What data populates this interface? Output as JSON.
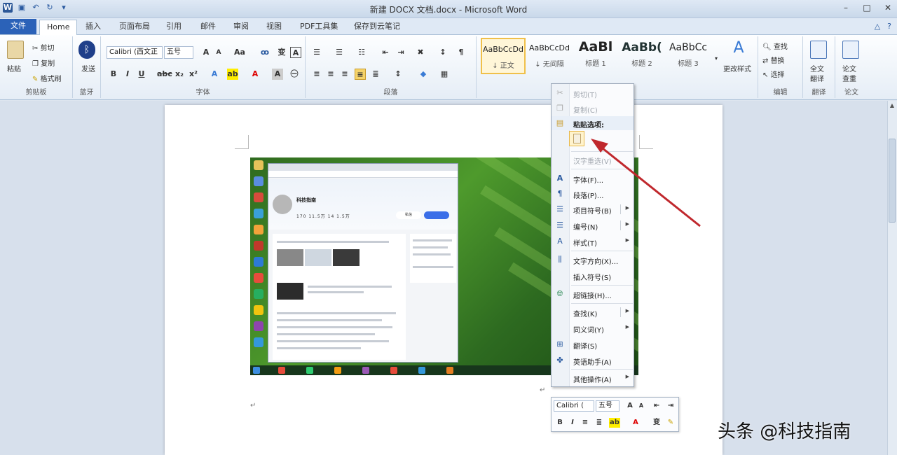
{
  "window": {
    "title": "新建 DOCX 文档.docx - Microsoft Word",
    "app_icon": "word-icon"
  },
  "tabs": [
    {
      "label": "文件"
    },
    {
      "label": "Home"
    },
    {
      "label": "插入"
    },
    {
      "label": "页面布局"
    },
    {
      "label": "引用"
    },
    {
      "label": "邮件"
    },
    {
      "label": "审阅"
    },
    {
      "label": "视图"
    },
    {
      "label": "PDF工具集"
    },
    {
      "label": "保存到云笔记"
    }
  ],
  "ribbon": {
    "clipboard": {
      "group_label": "剪贴板",
      "paste": "粘贴",
      "cut": "剪切",
      "copy": "复制",
      "format_painter": "格式刷"
    },
    "bluetooth": {
      "group_label": "蓝牙",
      "button": "发送"
    },
    "font": {
      "group_label": "字体",
      "font_name": "Calibri (西文正",
      "font_size": "五号"
    },
    "paragraph": {
      "group_label": "段落"
    },
    "styles": {
      "group_label": "样式",
      "items": [
        {
          "preview": "AaBbCcDd",
          "name": "↓ 正文"
        },
        {
          "preview": "AaBbCcDd",
          "name": "↓ 无间隔"
        },
        {
          "preview": "AaBl",
          "name": "标题 1"
        },
        {
          "preview": "AaBb(",
          "name": "标题 2"
        },
        {
          "preview": "AaBbCc",
          "name": "标题 3"
        }
      ],
      "change_styles": "更改样式"
    },
    "editing": {
      "group_label": "编辑",
      "find": "查找",
      "replace": "替换",
      "select": "选择"
    },
    "translate": {
      "group_label": "翻译",
      "button_line1": "全文",
      "button_line2": "翻译"
    },
    "paper": {
      "group_label": "论文",
      "button_line1": "论文",
      "button_line2": "查重"
    }
  },
  "context_menu": {
    "items": [
      {
        "label": "剪切(T)",
        "icon": "scissors-icon",
        "disabled": true
      },
      {
        "label": "复制(C)",
        "icon": "copy-icon",
        "disabled": true
      },
      {
        "label": "粘贴选项:",
        "icon": "paste-icon",
        "heading": true
      },
      {
        "label": "汉字重选(V)",
        "disabled": true
      },
      {
        "label": "字体(F)...",
        "icon": "font-icon"
      },
      {
        "label": "段落(P)...",
        "icon": "paragraph-icon"
      },
      {
        "label": "项目符号(B)",
        "icon": "bullets-icon",
        "submenu": true
      },
      {
        "label": "编号(N)",
        "icon": "numbering-icon",
        "submenu": true
      },
      {
        "label": "样式(T)",
        "icon": "styles-icon",
        "submenu": true
      },
      {
        "label": "文字方向(X)...",
        "icon": "text-direction-icon"
      },
      {
        "label": "插入符号(S)",
        "icon": "symbol-icon"
      },
      {
        "label": "超链接(H)...",
        "icon": "hyperlink-icon"
      },
      {
        "label": "查找(K)",
        "submenu": true
      },
      {
        "label": "同义词(Y)",
        "submenu": true
      },
      {
        "label": "翻译(S)",
        "icon": "translate-icon"
      },
      {
        "label": "英语助手(A)",
        "icon": "english-assistant-icon"
      },
      {
        "label": "其他操作(A)",
        "submenu": true
      }
    ]
  },
  "mini_toolbar": {
    "font_name": "Calibri (",
    "font_size": "五号"
  },
  "inserted_image": {
    "profile_name": "科技指南",
    "profile_stats": "170  11.5万  14  1.5万",
    "follow_button": "私信"
  },
  "watermark": "头条 @科技指南",
  "colors": {
    "file_tab": "#2b62b8",
    "ribbon_bg": "#e5edf6",
    "highlight_style": "#f0c04a",
    "annotation_arrow": "#c0282d"
  }
}
